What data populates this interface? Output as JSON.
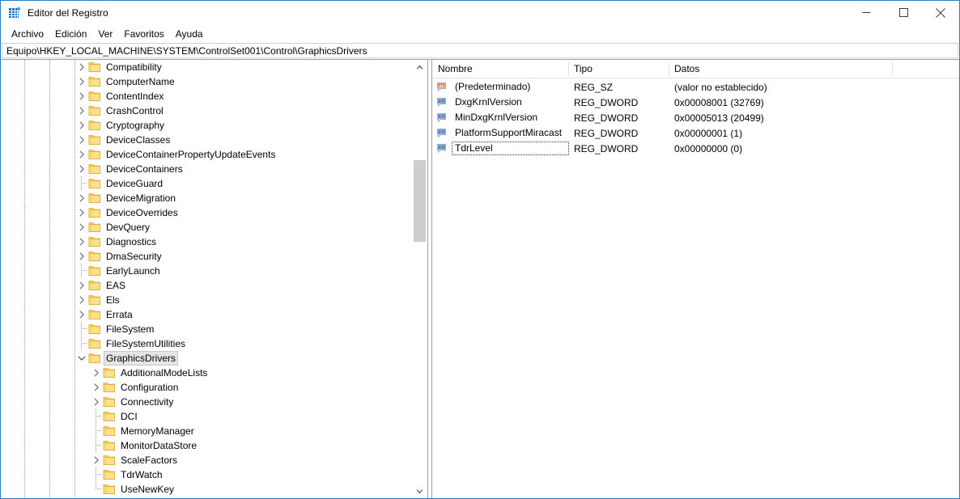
{
  "window": {
    "title": "Editor del Registro",
    "icon": "registry-editor-icon",
    "controls": {
      "minimize": "minimize-icon",
      "maximize": "maximize-icon",
      "close": "close-icon"
    },
    "accent_color": "#2a7cc7"
  },
  "menu": {
    "items": [
      {
        "label": "Archivo"
      },
      {
        "label": "Edición"
      },
      {
        "label": "Ver"
      },
      {
        "label": "Favoritos"
      },
      {
        "label": "Ayuda"
      }
    ]
  },
  "address": {
    "path": "Equipo\\HKEY_LOCAL_MACHINE\\SYSTEM\\ControlSet001\\Control\\GraphicsDrivers"
  },
  "tree": {
    "nodes": [
      {
        "label": "Compatibility",
        "depth": 3,
        "expandable": true,
        "expanded": false,
        "selected": false,
        "connector": "none"
      },
      {
        "label": "ComputerName",
        "depth": 3,
        "expandable": true,
        "expanded": false,
        "selected": false,
        "connector": "none"
      },
      {
        "label": "ContentIndex",
        "depth": 3,
        "expandable": true,
        "expanded": false,
        "selected": false,
        "connector": "none"
      },
      {
        "label": "CrashControl",
        "depth": 3,
        "expandable": true,
        "expanded": false,
        "selected": false,
        "connector": "none"
      },
      {
        "label": "Cryptography",
        "depth": 3,
        "expandable": true,
        "expanded": false,
        "selected": false,
        "connector": "none"
      },
      {
        "label": "DeviceClasses",
        "depth": 3,
        "expandable": true,
        "expanded": false,
        "selected": false,
        "connector": "none"
      },
      {
        "label": "DeviceContainerPropertyUpdateEvents",
        "depth": 3,
        "expandable": true,
        "expanded": false,
        "selected": false,
        "connector": "none"
      },
      {
        "label": "DeviceContainers",
        "depth": 3,
        "expandable": true,
        "expanded": false,
        "selected": false,
        "connector": "none"
      },
      {
        "label": "DeviceGuard",
        "depth": 3,
        "expandable": false,
        "expanded": false,
        "selected": false,
        "connector": "mid"
      },
      {
        "label": "DeviceMigration",
        "depth": 3,
        "expandable": true,
        "expanded": false,
        "selected": false,
        "connector": "none"
      },
      {
        "label": "DeviceOverrides",
        "depth": 3,
        "expandable": true,
        "expanded": false,
        "selected": false,
        "connector": "none"
      },
      {
        "label": "DevQuery",
        "depth": 3,
        "expandable": true,
        "expanded": false,
        "selected": false,
        "connector": "none"
      },
      {
        "label": "Diagnostics",
        "depth": 3,
        "expandable": true,
        "expanded": false,
        "selected": false,
        "connector": "none"
      },
      {
        "label": "DmaSecurity",
        "depth": 3,
        "expandable": true,
        "expanded": false,
        "selected": false,
        "connector": "none"
      },
      {
        "label": "EarlyLaunch",
        "depth": 3,
        "expandable": false,
        "expanded": false,
        "selected": false,
        "connector": "mid"
      },
      {
        "label": "EAS",
        "depth": 3,
        "expandable": true,
        "expanded": false,
        "selected": false,
        "connector": "none"
      },
      {
        "label": "Els",
        "depth": 3,
        "expandable": true,
        "expanded": false,
        "selected": false,
        "connector": "none"
      },
      {
        "label": "Errata",
        "depth": 3,
        "expandable": true,
        "expanded": false,
        "selected": false,
        "connector": "none"
      },
      {
        "label": "FileSystem",
        "depth": 3,
        "expandable": false,
        "expanded": false,
        "selected": false,
        "connector": "mid"
      },
      {
        "label": "FileSystemUtilities",
        "depth": 3,
        "expandable": false,
        "expanded": false,
        "selected": false,
        "connector": "mid"
      },
      {
        "label": "GraphicsDrivers",
        "depth": 3,
        "expandable": true,
        "expanded": true,
        "selected": true,
        "connector": "none"
      },
      {
        "label": "AdditionalModeLists",
        "depth": 4,
        "expandable": true,
        "expanded": false,
        "selected": false,
        "connector": "none"
      },
      {
        "label": "Configuration",
        "depth": 4,
        "expandable": true,
        "expanded": false,
        "selected": false,
        "connector": "none"
      },
      {
        "label": "Connectivity",
        "depth": 4,
        "expandable": true,
        "expanded": false,
        "selected": false,
        "connector": "none"
      },
      {
        "label": "DCI",
        "depth": 4,
        "expandable": false,
        "expanded": false,
        "selected": false,
        "connector": "mid"
      },
      {
        "label": "MemoryManager",
        "depth": 4,
        "expandable": false,
        "expanded": false,
        "selected": false,
        "connector": "mid"
      },
      {
        "label": "MonitorDataStore",
        "depth": 4,
        "expandable": false,
        "expanded": false,
        "selected": false,
        "connector": "mid"
      },
      {
        "label": "ScaleFactors",
        "depth": 4,
        "expandable": true,
        "expanded": false,
        "selected": false,
        "connector": "none"
      },
      {
        "label": "TdrWatch",
        "depth": 4,
        "expandable": false,
        "expanded": false,
        "selected": false,
        "connector": "mid"
      },
      {
        "label": "UseNewKey",
        "depth": 4,
        "expandable": false,
        "expanded": false,
        "selected": false,
        "connector": "last"
      }
    ],
    "scrollbar": {
      "up_icon": "scroll-up-icon",
      "down_icon": "scroll-down-icon",
      "thumb_top_pct": 21,
      "thumb_height_pct": 20
    }
  },
  "values": {
    "columns": [
      {
        "label": "Nombre"
      },
      {
        "label": "Tipo"
      },
      {
        "label": "Datos"
      }
    ],
    "rows": [
      {
        "icon": "string-value-icon",
        "name": "(Predeterminado)",
        "type": "REG_SZ",
        "data": "(valor no establecido)",
        "focused": false
      },
      {
        "icon": "dword-value-icon",
        "name": "DxgKrnlVersion",
        "type": "REG_DWORD",
        "data": "0x00008001 (32769)",
        "focused": false
      },
      {
        "icon": "dword-value-icon",
        "name": "MinDxgKrnlVersion",
        "type": "REG_DWORD",
        "data": "0x00005013 (20499)",
        "focused": false
      },
      {
        "icon": "dword-value-icon",
        "name": "PlatformSupportMiracast",
        "type": "REG_DWORD",
        "data": "0x00000001 (1)",
        "focused": false
      },
      {
        "icon": "dword-value-icon",
        "name": "TdrLevel",
        "type": "REG_DWORD",
        "data": "0x00000000 (0)",
        "focused": true
      }
    ]
  }
}
